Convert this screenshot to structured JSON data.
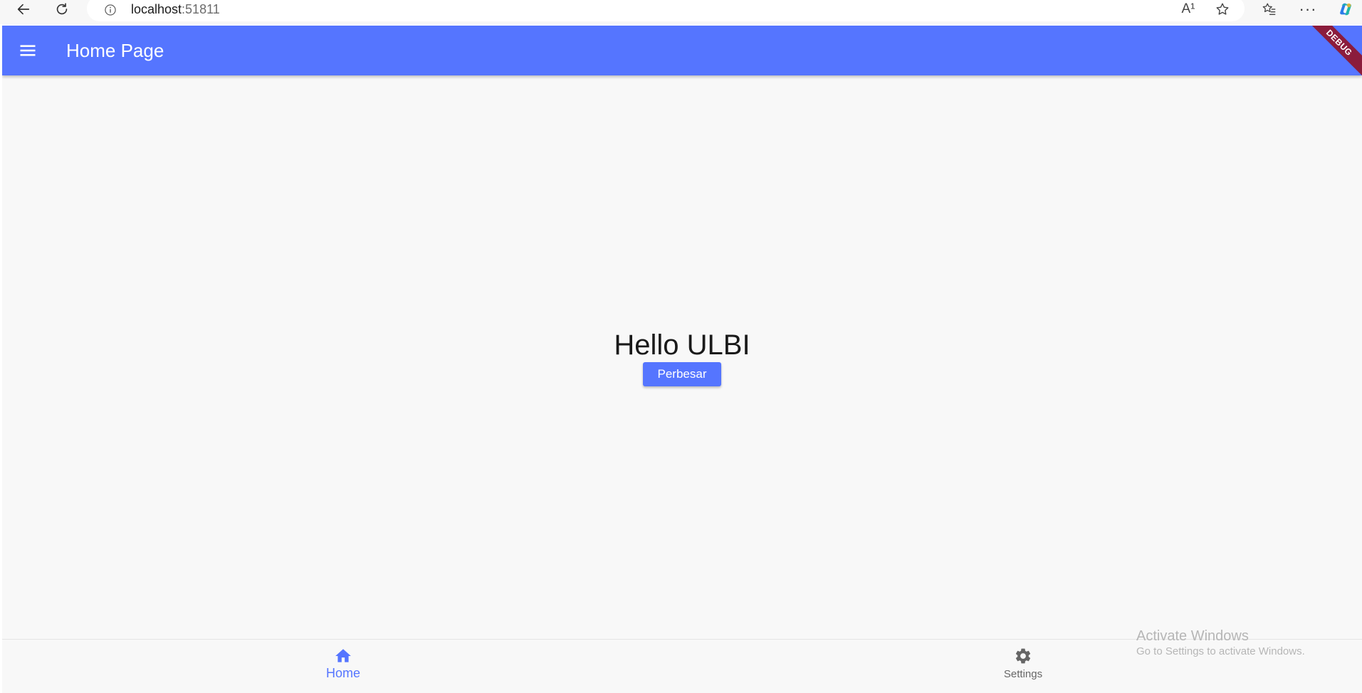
{
  "browser": {
    "address_host": "localhost",
    "address_port": ":51811",
    "read_aloud_glyph": "A¹"
  },
  "app": {
    "title": "Home Page",
    "debug_banner": "DEBUG",
    "accent_color": "#5575ff",
    "body": {
      "headline": "Hello ULBI",
      "button_label": "Perbesar"
    },
    "bottom_nav": {
      "items": [
        {
          "label": "Home",
          "icon": "home-icon",
          "selected": true
        },
        {
          "label": "Settings",
          "icon": "settings-icon",
          "selected": false
        }
      ]
    }
  },
  "watermark": {
    "title": "Activate Windows",
    "subtitle": "Go to Settings to activate Windows."
  }
}
